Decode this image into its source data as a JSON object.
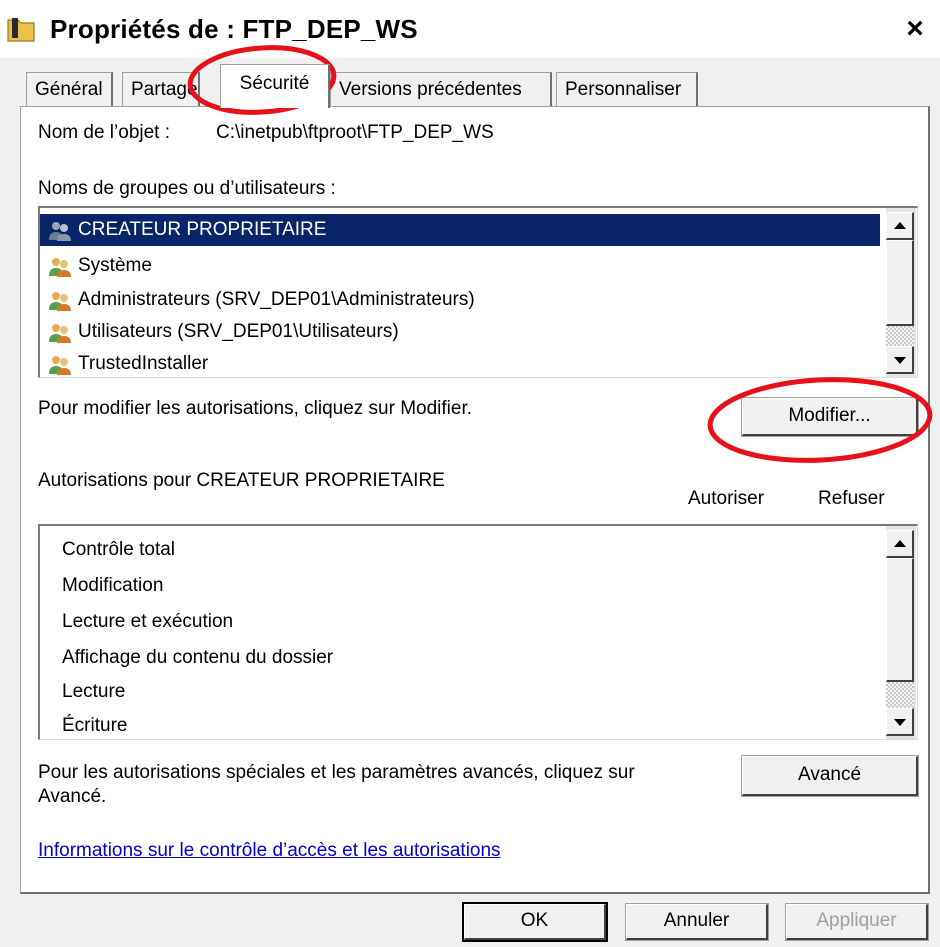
{
  "window": {
    "title": "Propriétés de : FTP_DEP_WS",
    "close_glyph": "×"
  },
  "tabs": [
    {
      "label": "Général"
    },
    {
      "label": "Partage"
    },
    {
      "label": "Sécurité",
      "active": true
    },
    {
      "label": "Versions précédentes"
    },
    {
      "label": "Personnaliser"
    }
  ],
  "object": {
    "label": "Nom de l’objet :",
    "path": "C:\\inetpub\\ftproot\\FTP_DEP_WS"
  },
  "groups": {
    "label": "Noms de groupes ou d’utilisateurs :",
    "items": [
      {
        "name": "CREATEUR PROPRIETAIRE",
        "selected": true,
        "icon": "users-icon"
      },
      {
        "name": "Système",
        "icon": "users-icon"
      },
      {
        "name": "Administrateurs (SRV_DEP01\\Administrateurs)",
        "icon": "users-icon"
      },
      {
        "name": "Utilisateurs (SRV_DEP01\\Utilisateurs)",
        "icon": "users-icon"
      },
      {
        "name": "TrustedInstaller",
        "icon": "users-icon"
      }
    ]
  },
  "modify": {
    "hint": "Pour modifier les autorisations, cliquez sur Modifier.",
    "button": "Modifier..."
  },
  "permissions": {
    "label": "Autorisations pour CREATEUR PROPRIETAIRE",
    "allow_header": "Autoriser",
    "deny_header": "Refuser",
    "items": [
      {
        "name": "Contrôle total"
      },
      {
        "name": "Modification"
      },
      {
        "name": "Lecture et exécution"
      },
      {
        "name": "Affichage du contenu du dossier"
      },
      {
        "name": "Lecture"
      },
      {
        "name": "Écriture"
      }
    ]
  },
  "advanced": {
    "hint_line1": "Pour les autorisations spéciales et les paramètres avancés, cliquez sur",
    "hint_line2": "Avancé.",
    "button": "Avancé"
  },
  "help_link": "Informations sur le contrôle d’accès et les autorisations",
  "footer": {
    "ok": "OK",
    "cancel": "Annuler",
    "apply": "Appliquer"
  },
  "colors": {
    "selection": "#0a246a",
    "annotation": "#e8101a",
    "link": "#0000cc"
  }
}
